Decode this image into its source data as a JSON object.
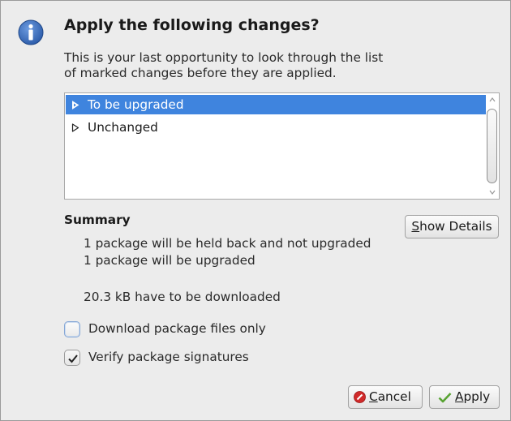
{
  "dialog": {
    "title": "Apply the following changes?",
    "description_line1": "This is your last opportunity to look through the list",
    "description_line2": "of marked changes before they are applied.",
    "icon": "information-icon"
  },
  "changes_list": {
    "items": [
      {
        "label": "To be upgraded",
        "selected": true,
        "icon": "expand-arrow-icon"
      },
      {
        "label": "Unchanged",
        "selected": false,
        "icon": "expand-arrow-icon"
      }
    ]
  },
  "summary": {
    "title": "Summary",
    "show_details_mnemonic": "S",
    "show_details_rest": "how Details",
    "held_back": "1 package will be held back and not upgraded",
    "upgraded": "1 package will be upgraded",
    "download_size": "20.3 kB have to be downloaded"
  },
  "options": {
    "download_only_label": "Download package files only",
    "download_only_checked": false,
    "verify_signatures_label": "Verify package signatures",
    "verify_signatures_checked": true
  },
  "buttons": {
    "cancel_mnemonic": "C",
    "cancel_rest": "ancel",
    "apply_mnemonic": "A",
    "apply_rest": "pply"
  },
  "colors": {
    "selection": "#3f84de",
    "info_icon": "#2f63b3",
    "cancel_icon": "#d02a2a",
    "apply_icon": "#58a332"
  }
}
